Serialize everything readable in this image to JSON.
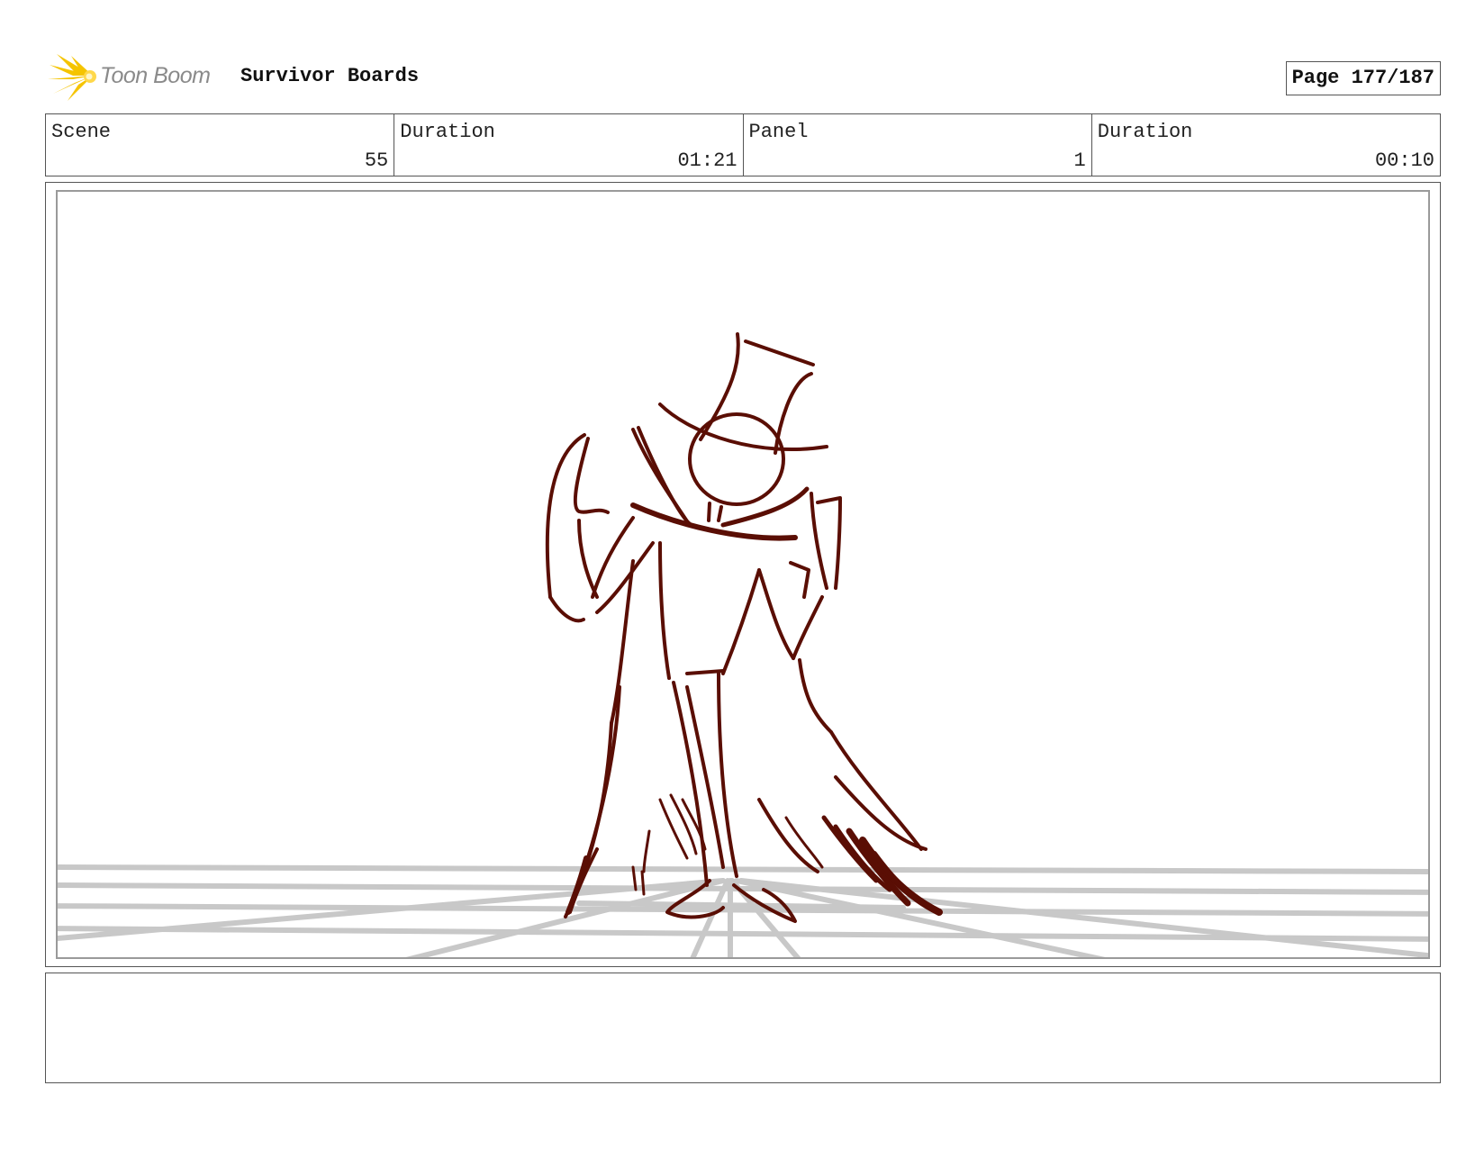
{
  "header": {
    "logo_text": "Toon Boom",
    "project_title": "Survivor Boards",
    "page_label": "Page 177/187"
  },
  "info": {
    "scene_label": "Scene",
    "scene_value": "55",
    "scene_duration_label": "Duration",
    "scene_duration_value": "01:21",
    "panel_label": "Panel",
    "panel_value": "1",
    "panel_duration_label": "Duration",
    "panel_duration_value": "00:10"
  },
  "panel": {
    "sketch_color": "#5a0e04",
    "guide_color": "#c8c8c8"
  },
  "notes": {
    "text": ""
  },
  "colors": {
    "logo_yellow": "#f5c400",
    "logo_gray": "#8a8a8a",
    "border": "#555555"
  }
}
